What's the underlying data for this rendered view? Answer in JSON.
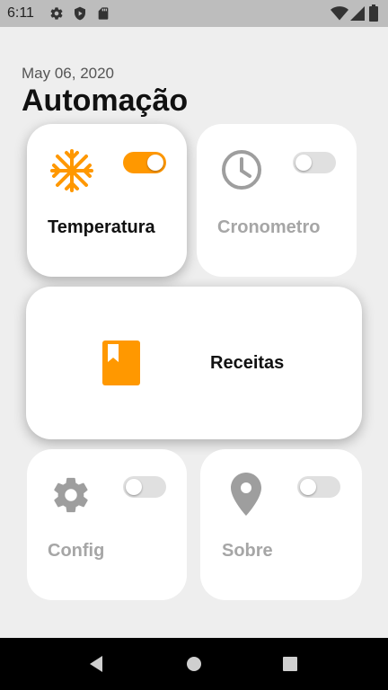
{
  "status_bar": {
    "time": "6:11",
    "left_icons": [
      "gear-icon",
      "shield-play-icon",
      "sd-card-icon"
    ],
    "right_icons": [
      "wifi-icon",
      "signal-icon",
      "battery-icon"
    ]
  },
  "header": {
    "date": "May 06, 2020",
    "title": "Automação"
  },
  "cards": {
    "temperatura": {
      "label": "Temperatura",
      "icon": "snowflake-icon",
      "toggle_on": true
    },
    "cronometro": {
      "label": "Cronometro",
      "icon": "clock-icon",
      "toggle_on": false
    },
    "receitas": {
      "label": "Receitas",
      "icon": "book-icon"
    },
    "config": {
      "label": "Config",
      "icon": "gear-icon",
      "toggle_on": false
    },
    "sobre": {
      "label": "Sobre",
      "icon": "location-pin-icon",
      "toggle_on": false
    }
  },
  "nav_bar": {
    "buttons": [
      "back-icon",
      "home-icon",
      "recents-icon"
    ]
  },
  "colors": {
    "accent": "#ff9800",
    "inactive": "#9e9e9e",
    "background": "#eeeeee"
  }
}
